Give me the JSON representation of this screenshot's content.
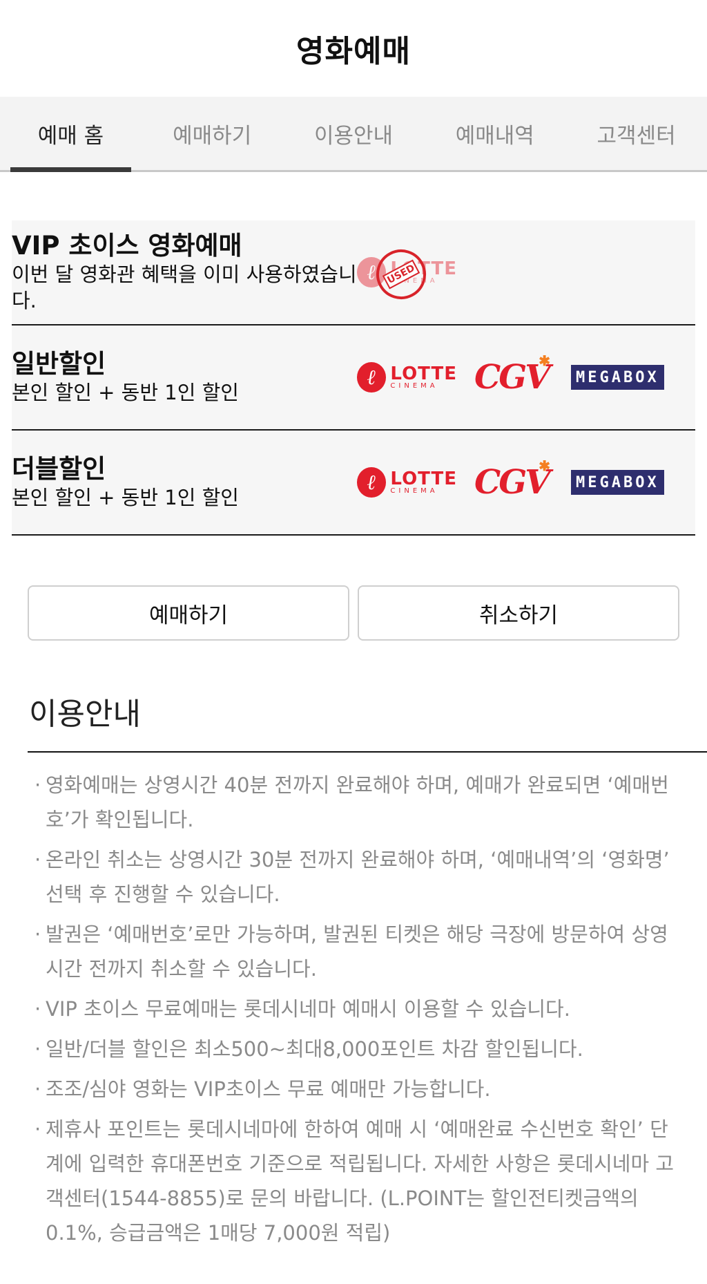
{
  "header": {
    "title": "영화예매"
  },
  "tabs": [
    {
      "label": "예매 홈",
      "active": true
    },
    {
      "label": "예매하기",
      "active": false
    },
    {
      "label": "이용안내",
      "active": false
    },
    {
      "label": "예매내역",
      "active": false
    },
    {
      "label": "고객센터",
      "active": false
    }
  ],
  "cards": [
    {
      "title": "VIP 초이스 영화예매",
      "desc": "이번 달 영화관 혜택을 이미 사용하였습니다.",
      "stamp": "USED"
    },
    {
      "title": "일반할인",
      "desc": "본인 할인 + 동반 1인 할인"
    },
    {
      "title": "더블할인",
      "desc": "본인 할인 + 동반 1인 할인"
    }
  ],
  "logos": {
    "lotte_mark": "ℓ",
    "lotte_big": "LOTTE",
    "lotte_small": "CINEMA",
    "cgv": "CGV",
    "mega": "MEGABOX"
  },
  "buttons": {
    "reserve": "예매하기",
    "cancel": "취소하기"
  },
  "guide": {
    "title": "이용안내",
    "items": [
      "영화예매는 상영시간 40분 전까지 완료해야 하며, 예매가 완료되면 ‘예매번호’가 확인됩니다.",
      "온라인 취소는 상영시간 30분 전까지 완료해야 하며, ‘예매내역’의 ‘영화명’ 선택 후 진행할 수 있습니다.",
      "발권은 ‘예매번호’로만 가능하며, 발권된 티켓은 해당 극장에 방문하여 상영시간 전까지 취소할 수 있습니다.",
      "VIP 초이스 무료예매는 롯데시네마 예매시 이용할 수 있습니다.",
      "일반/더블 할인은 최소500~최대8,000포인트 차감 할인됩니다.",
      "조조/심야 영화는 VIP초이스 무료 예매만 가능합니다.",
      "제휴사 포인트는 롯데시네마에 한하여 예매 시 ‘예매완료 수신번호 확인’ 단계에 입력한 휴대폰번호 기준으로 적립됩니다. 자세한 사항은 롯데시네마 고객센터(1544-8855)로 문의 바랍니다. (L.POINT는 할인전티켓금액의 0.1%, 승급금액은 1매당 7,000원 적립)"
    ]
  },
  "colors": {
    "lotte_red": "#e21f2c",
    "megabox_navy": "#2e2e6e",
    "cgv_star": "#f47f20"
  }
}
